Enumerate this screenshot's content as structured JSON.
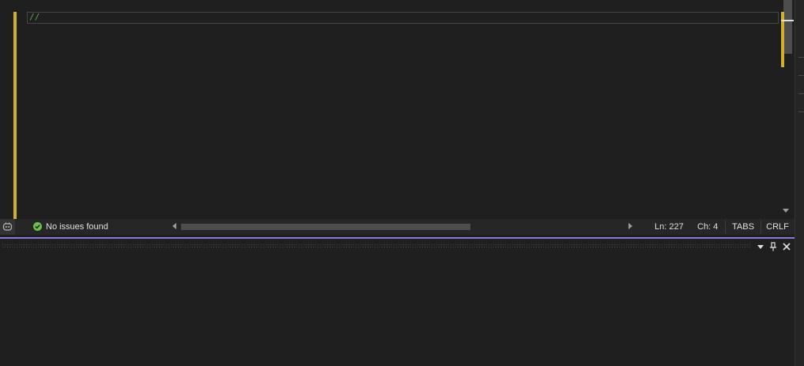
{
  "editor": {
    "current_line_text": "//"
  },
  "statusbar": {
    "issues_text": "No issues found",
    "line": "Ln: 227",
    "column": "Ch: 4",
    "indentation": "TABS",
    "line_endings": "CRLF"
  },
  "icons": {
    "assistant": "copilot-icon",
    "issues": "check-circle-icon",
    "scroll_left": "chevron-left-icon",
    "scroll_right": "chevron-right-icon",
    "scroll_down": "chevron-down-icon",
    "tool_menu": "dropdown-icon",
    "tool_pin": "pin-icon",
    "tool_close": "close-icon"
  },
  "colors": {
    "change_marker": "#d3b02a",
    "comment": "#57a64a",
    "splitter_accent": "#8b7ad6",
    "ok": "#6cc04a"
  }
}
